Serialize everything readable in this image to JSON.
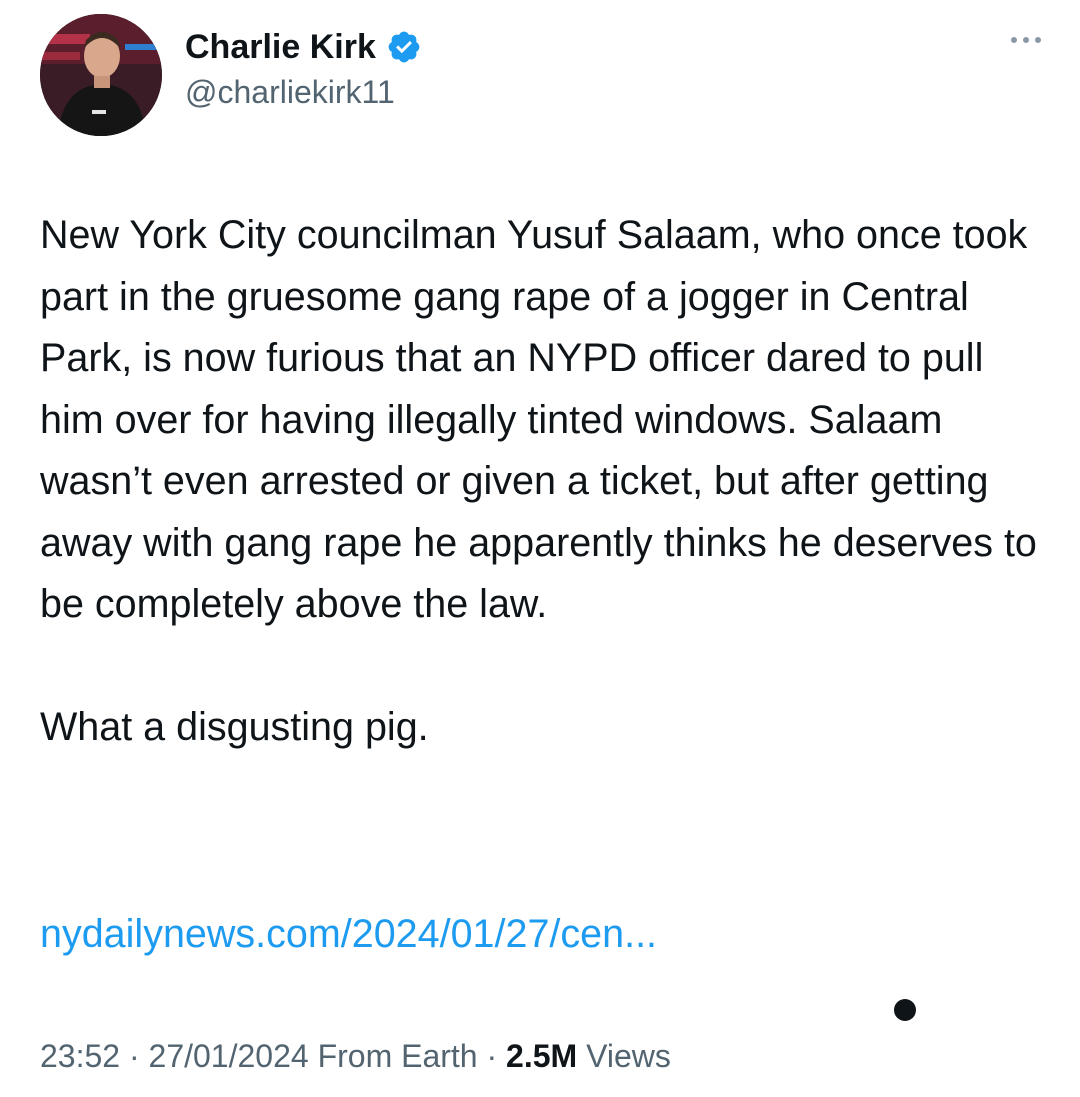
{
  "author": {
    "display_name": "Charlie Kirk",
    "handle": "@charliekirk11",
    "verified": true,
    "verified_color": "#1d9bf0"
  },
  "icons": {
    "more": "more-horizontal-icon",
    "verified": "verified-badge-icon"
  },
  "tweet": {
    "paragraph_1": "New York City councilman Yusuf Salaam, who once took part in the gruesome gang rape of a jogger in Central Park, is now furious that an NYPD officer dared to pull him over for having illegally tinted windows. Salaam wasn’t even arrested or given a ticket, but after getting away with gang rape he apparently thinks he deserves to be completely above the law.",
    "paragraph_2": "What a disgusting pig.",
    "link_text": "nydailynews.com/2024/01/27/cen...",
    "link_color": "#1d9bf0"
  },
  "meta": {
    "time": "23:52",
    "separator_1": " · ",
    "date": "27/01/2024",
    "source": " From Earth",
    "separator_2": " · ",
    "views_count": "2.5M",
    "views_label": " Views"
  }
}
